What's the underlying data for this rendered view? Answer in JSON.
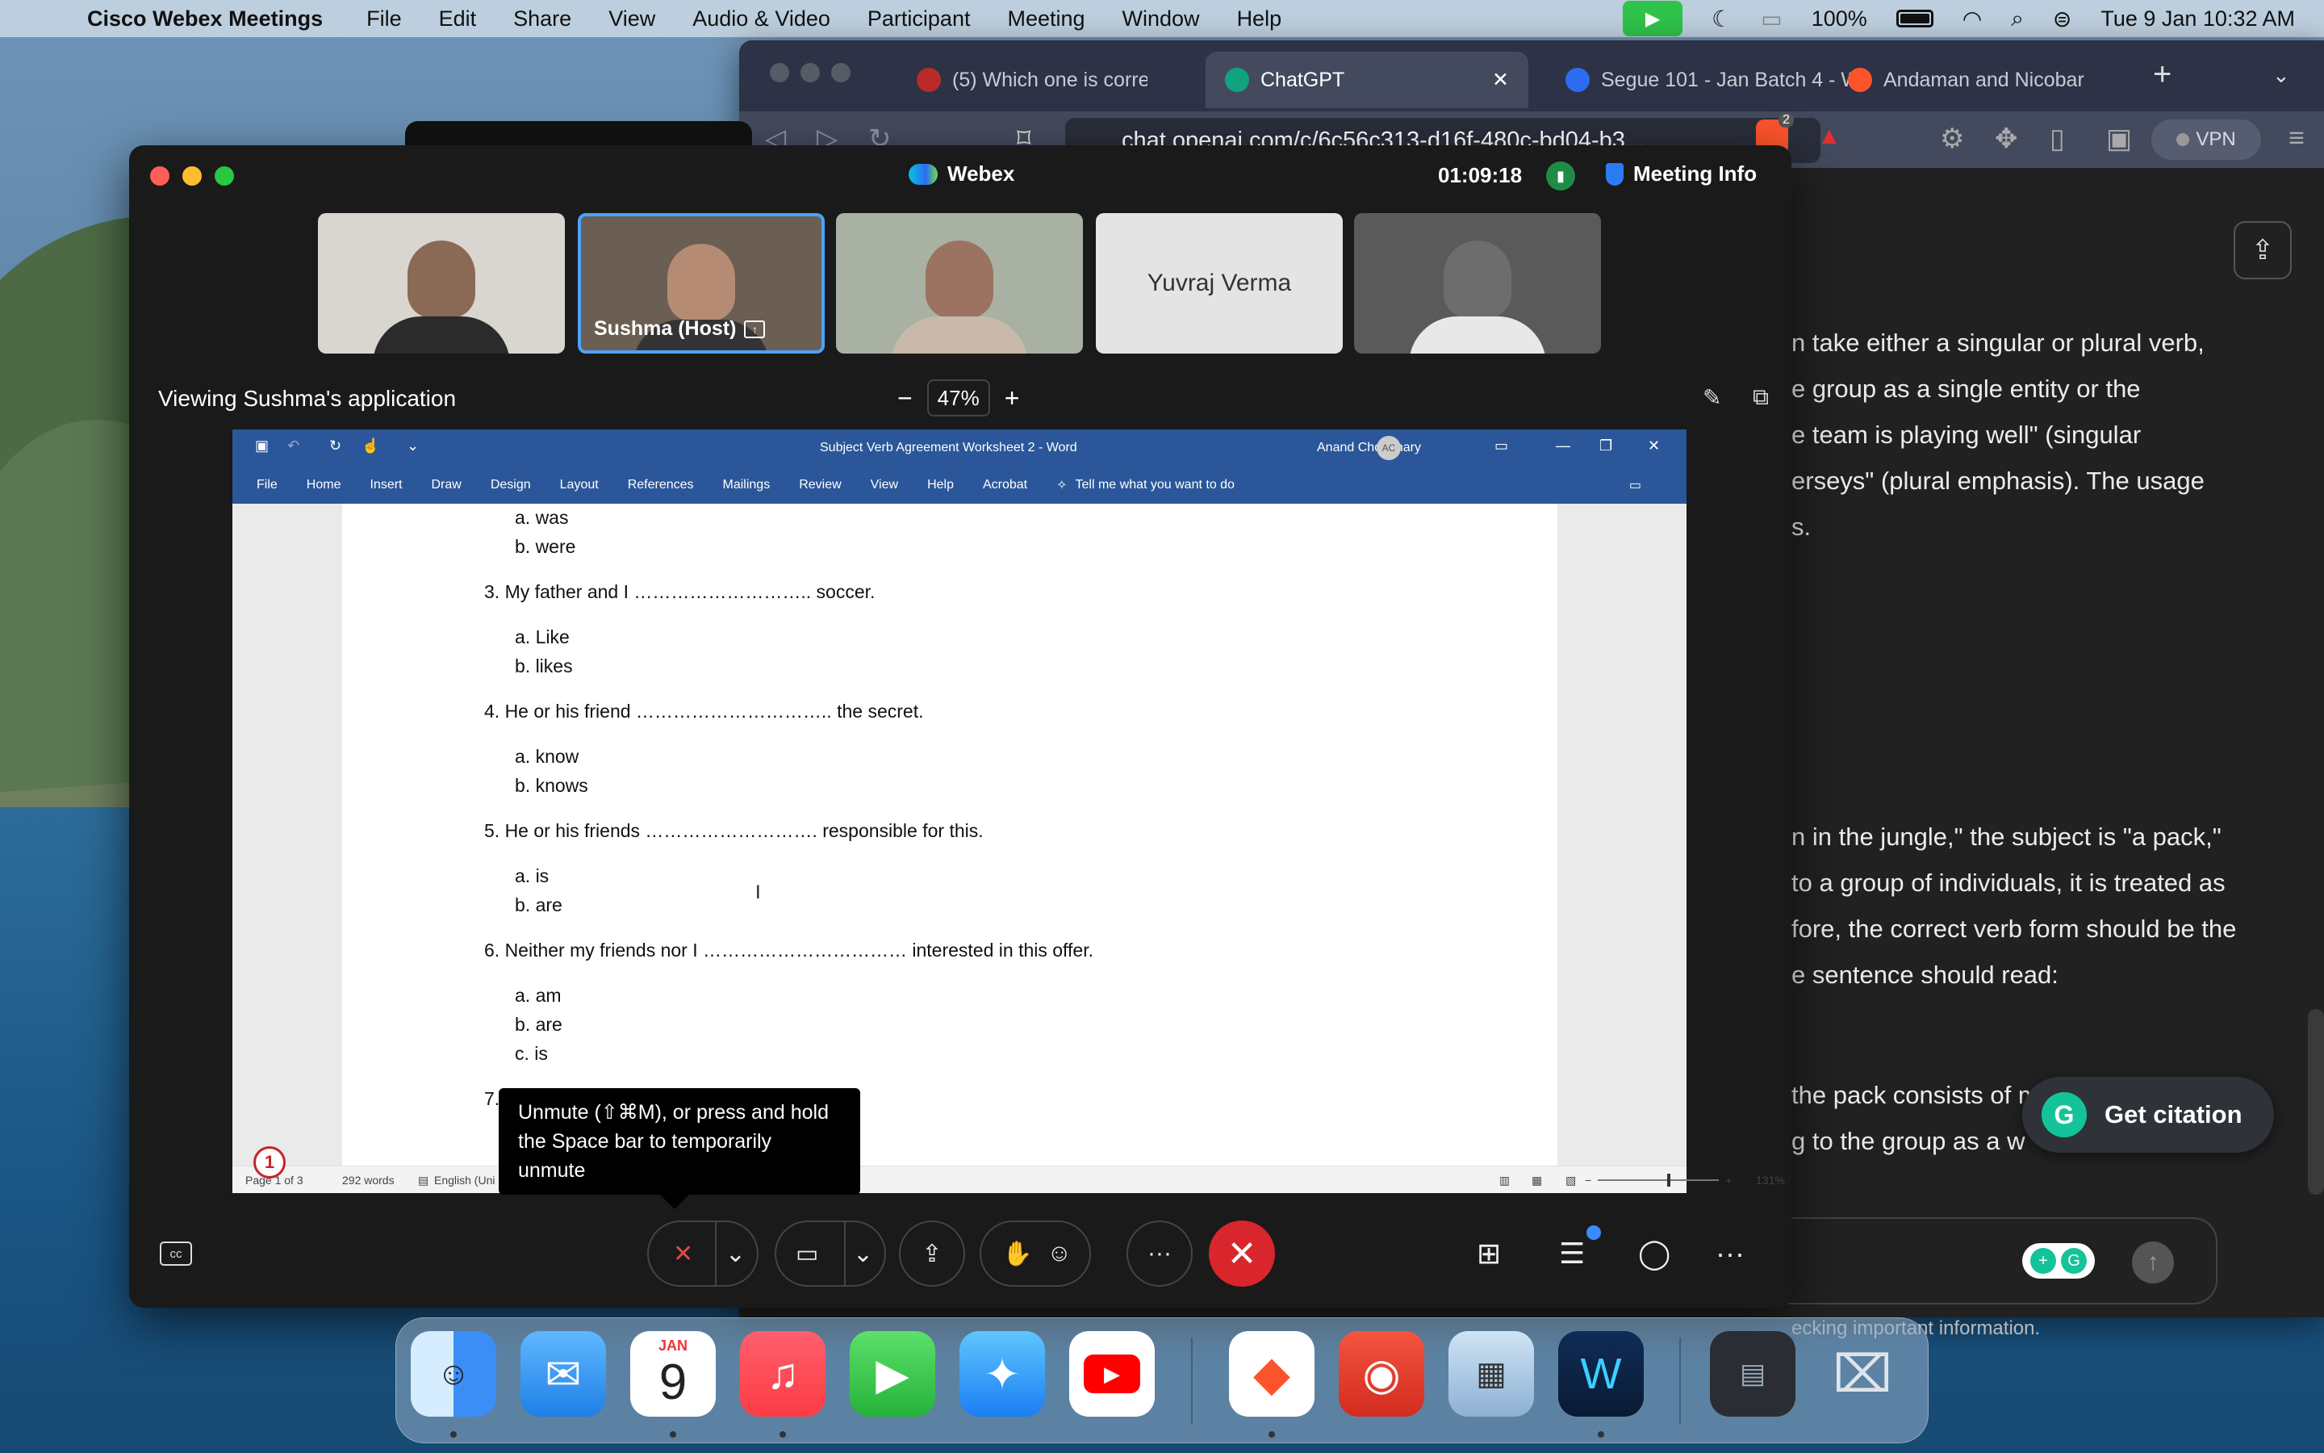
{
  "menubar": {
    "app_name": "Cisco Webex Meetings",
    "menus": [
      "File",
      "Edit",
      "Share",
      "View",
      "Audio & Video",
      "Participant",
      "Meeting",
      "Window",
      "Help"
    ],
    "battery": "100%",
    "datetime": "Tue 9 Jan  10:32 AM"
  },
  "browser": {
    "tabs": [
      {
        "label": "(5) Which one is correct, an",
        "icon": "quora-icon",
        "color": "#b92b27"
      },
      {
        "label": "ChatGPT",
        "icon": "chatgpt-icon",
        "color": "#10a37f"
      },
      {
        "label": "Segue 101 - Jan Batch 4 - W",
        "icon": "webex-icon",
        "color": "#2d6cf0"
      },
      {
        "label": "Andaman and Nicobar - Bra",
        "icon": "brave-icon",
        "color": "#fb542b"
      }
    ],
    "url": "chat.openai.com/c/6c56c313-d16f-480c-bd04-b3...",
    "brave_badge": "2",
    "vpn_label": "VPN",
    "chat_lines_top": [
      "n take either a singular or plural verb,",
      "e group as a single entity or the",
      "e team is playing well\" (singular",
      "erseys\" (plural emphasis). The usage",
      "s."
    ],
    "chat_lines_mid": [
      "n in the jungle,\" the subject is \"a pack,\"",
      " to a group of individuals, it is treated as",
      "fore, the correct verb form should be the",
      "e sentence should read:"
    ],
    "chat_lines_bottom": [
      "the pack consists of m",
      "g to the group as a w"
    ],
    "citation_button": "Get citation",
    "disclaimer": "ecking important information."
  },
  "webex": {
    "title": "Webex",
    "timer": "01:09:18",
    "meeting_info": "Meeting Info",
    "participants": [
      {
        "name": "",
        "skin": "#8a6a55",
        "shirt": "#2b2b2b",
        "bg": "#d9d6d0"
      },
      {
        "name": "Sushma  (Host)",
        "skin": "#b58b74",
        "shirt": "#333",
        "bg": "#6b5e52",
        "active": true,
        "sharing": true
      },
      {
        "name": "",
        "skin": "#9b7360",
        "shirt": "#c9b9aa",
        "bg": "#a9b1a3"
      },
      {
        "name": "Yuvraj Verma",
        "name_only": true
      },
      {
        "name": "",
        "skin": "#6d6d6d",
        "shirt": "#e8e8e8",
        "bg": "#5a5a5a"
      }
    ],
    "viewing_label": "Viewing Sushma's application",
    "zoom_value": "47%",
    "zoom_minus": "−",
    "zoom_plus": "+",
    "tooltip": "Unmute (⇧⌘M), or press and hold the Space bar to temporarily unmute",
    "notification_count": "1"
  },
  "word": {
    "doc_title": "Subject Verb Agreement Worksheet 2  -  Word",
    "user": "Anand Choudhary",
    "user_initials": "AC",
    "ribbon_tabs": [
      "File",
      "Home",
      "Insert",
      "Draw",
      "Design",
      "Layout",
      "References",
      "Mailings",
      "Review",
      "View",
      "Help",
      "Acrobat"
    ],
    "tell_me": "Tell me what you want to do",
    "lines": [
      {
        "text": "a.    was",
        "indent": 1
      },
      {
        "text": "b.    were",
        "indent": 1
      },
      {
        "text": "3. My father and I ……………………….. soccer.",
        "indent": 0
      },
      {
        "text": "a.    Like",
        "indent": 1
      },
      {
        "text": "b.    likes",
        "indent": 1
      },
      {
        "text": "4. He or his friend ………………………….. the secret.",
        "indent": 0
      },
      {
        "text": "a.    know",
        "indent": 1
      },
      {
        "text": "b.    knows",
        "indent": 1
      },
      {
        "text": "5. He or his friends ………………………. responsible for this.",
        "indent": 0
      },
      {
        "text": "a.    is",
        "indent": 1
      },
      {
        "text": "b.    are",
        "indent": 1
      },
      {
        "text": "6. Neither my friends nor I …………………………… interested in this offer.",
        "indent": 0
      },
      {
        "text": "a.    am",
        "indent": 1
      },
      {
        "text": "b.    are",
        "indent": 1
      },
      {
        "text": "c.    is",
        "indent": 1
      },
      {
        "text": "7.                                                 ken.",
        "indent": 0
      }
    ],
    "status_page": "Page 1 of 3",
    "status_words": "292 words",
    "status_lang": "English (Uni",
    "status_zoom": "131%"
  },
  "dock": {
    "calendar_month": "JAN",
    "calendar_day": "9"
  }
}
